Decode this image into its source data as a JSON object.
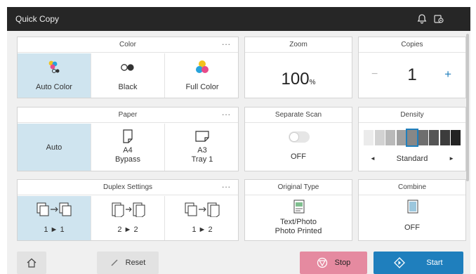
{
  "titlebar": {
    "title": "Quick Copy",
    "icons": [
      "bell-icon",
      "settings-icon"
    ]
  },
  "color": {
    "label": "Color",
    "more": "...",
    "options": [
      {
        "label": "Auto Color",
        "icon": "auto-color-icon",
        "selected": true
      },
      {
        "label": "Black",
        "icon": "black-icon",
        "selected": false
      },
      {
        "label": "Full Color",
        "icon": "full-color-icon",
        "selected": false
      }
    ]
  },
  "zoom": {
    "label": "Zoom",
    "value": "100",
    "unit": "%"
  },
  "copies": {
    "label": "Copies",
    "value": "1",
    "minus": "−",
    "plus": "+"
  },
  "paper": {
    "label": "Paper",
    "more": "...",
    "options": [
      {
        "label": "Auto",
        "line2": "",
        "selected": true
      },
      {
        "label": "A4",
        "line2": "Bypass",
        "selected": false
      },
      {
        "label": "A3",
        "line2": "Tray 1",
        "selected": false
      }
    ]
  },
  "separate_scan": {
    "label": "Separate Scan",
    "value": "OFF",
    "on": false
  },
  "density": {
    "label": "Density",
    "value": "Standard",
    "left": "◄",
    "right": "►",
    "level": 5,
    "levels": 9
  },
  "duplex": {
    "label": "Duplex Settings",
    "more": "...",
    "options": [
      {
        "label": "1 ► 1",
        "selected": true
      },
      {
        "label": "2 ► 2",
        "selected": false
      },
      {
        "label": "1 ► 2",
        "selected": false
      }
    ]
  },
  "original_type": {
    "label": "Original Type",
    "line1": "Text/Photo",
    "line2": "Photo Printed"
  },
  "combine": {
    "label": "Combine",
    "value": "OFF"
  },
  "bottom": {
    "reset": "Reset",
    "stop": "Stop",
    "start": "Start"
  },
  "colors": {
    "accent": "#1f7fbd",
    "stop": "#e58aa0",
    "selected": "#cfe4ef"
  }
}
